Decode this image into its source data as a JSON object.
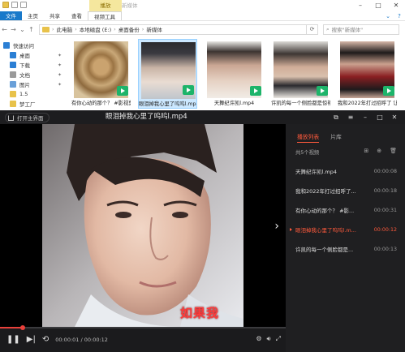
{
  "explorer": {
    "context_tab": "播放",
    "window_title": "新媒体",
    "ribbon_tabs": [
      "文件",
      "主页",
      "共享",
      "查看",
      "视频工具"
    ],
    "address": [
      "此电脑",
      "本地磁盘 (E:)",
      "桌面备份",
      "新媒体"
    ],
    "search_placeholder": "搜索\"新媒体\"",
    "nav_items": [
      {
        "label": "快速访问",
        "color": "#2b7fd4"
      },
      {
        "label": "桌面",
        "color": "#2b7fd4"
      },
      {
        "label": "下载",
        "color": "#2b7fd4"
      },
      {
        "label": "文档",
        "color": "#9a9a9a"
      },
      {
        "label": "图片",
        "color": "#6aa0d8"
      },
      {
        "label": "1.5",
        "color": "#e8c24a"
      },
      {
        "label": "梦工厂",
        "color": "#e8c24a"
      }
    ],
    "files": [
      {
        "name": "有你心动的那个？ #影视剪"
      },
      {
        "name": "眼泪掉我心里了呜呜l.mp4",
        "selected": true
      },
      {
        "name": "天舞纪许凯l.mp4"
      },
      {
        "name": "许凯的每一个侧脸都是惊艳"
      },
      {
        "name": "我和2022年打过招呼了 让它"
      }
    ]
  },
  "player": {
    "open_label": "打开主界面",
    "title": "眼泪掉我心里了呜呜l.mp4",
    "subtitle_text": "如果我",
    "time_current": "00:00:01",
    "time_total": "00:00:12",
    "progress": 0.08,
    "playlist": {
      "tabs": [
        "播放列表",
        "片库"
      ],
      "count": "共5个视频",
      "items": [
        {
          "name": "天舞纪许凯l.mp4",
          "duration": "00:00:08"
        },
        {
          "name": "我和2022年打过招呼了...",
          "duration": "00:00:18"
        },
        {
          "name": "有你心动的那个？ #影...",
          "duration": "00:00:31"
        },
        {
          "name": "眼泪掉我心里了呜呜l.m...",
          "duration": "00:00:12",
          "active": true
        },
        {
          "name": "许凯的每一个侧脸都是...",
          "duration": "00:00:13"
        }
      ]
    }
  }
}
